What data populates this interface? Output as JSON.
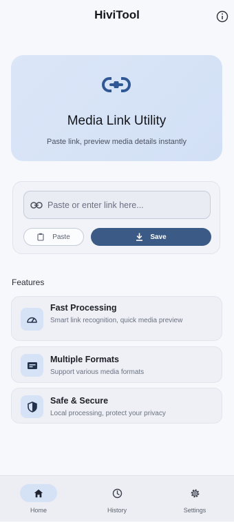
{
  "header": {
    "title": "HiviTool"
  },
  "hero": {
    "title": "Media Link Utility",
    "subtitle": "Paste link, preview media details instantly"
  },
  "input": {
    "placeholder": "Paste or enter link here...",
    "value": "",
    "paste_label": "Paste",
    "save_label": "Save"
  },
  "features": {
    "heading": "Features",
    "items": [
      {
        "title": "Fast Processing",
        "desc": "Smart link recognition, quick media preview",
        "icon": "speed-icon"
      },
      {
        "title": "Multiple Formats",
        "desc": "Support various media formats",
        "icon": "formats-icon"
      },
      {
        "title": "Safe & Secure",
        "desc": "Local processing, protect your privacy",
        "icon": "shield-icon"
      }
    ]
  },
  "nav": {
    "items": [
      {
        "label": "Home",
        "icon": "home-icon",
        "active": true
      },
      {
        "label": "History",
        "icon": "history-icon",
        "active": false
      },
      {
        "label": "Settings",
        "icon": "gear-icon",
        "active": false
      }
    ]
  },
  "colors": {
    "accent": "#3c5a86",
    "hero_bg": "#d2e0f6",
    "page_bg": "#f7f8fc"
  }
}
